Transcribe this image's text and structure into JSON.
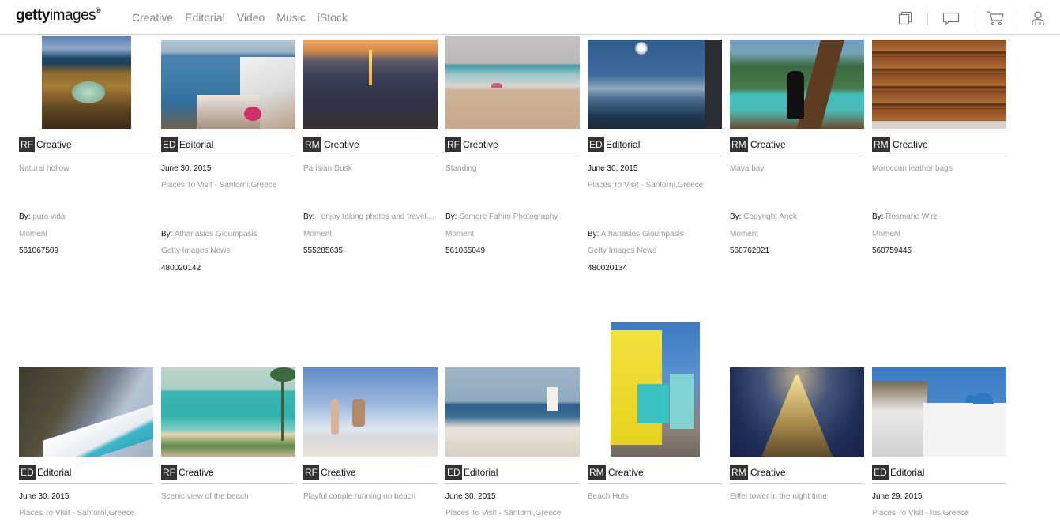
{
  "header": {
    "logo_bold": "getty",
    "logo_light": "images",
    "logo_reg": "®",
    "nav": [
      "Creative",
      "Editorial",
      "Video",
      "Music",
      "iStock"
    ],
    "icons": [
      "boards-icon",
      "chat-icon",
      "cart-icon",
      "user-icon"
    ]
  },
  "by_label": "By:",
  "results": [
    {
      "badge": "RF",
      "type": "Creative",
      "title": "Natural hollow",
      "by": "pura vida",
      "collection": "Moment",
      "id": "561067509",
      "image": "rocky coastline with green pool"
    },
    {
      "badge": "ED",
      "type": "Editorial",
      "date": "June 30, 2015",
      "caption": "Places To Visit - Santorni,Greece",
      "by": "Athanasios Gioumpasis",
      "collection": "Getty Images News",
      "id": "480020142",
      "image": "Santorini white houses over sea"
    },
    {
      "badge": "RM",
      "type": "Creative",
      "title": "Parisian Dusk",
      "by": "I enjoy taking photos and traveli...",
      "collection": "Moment",
      "id": "555285635",
      "image": "Paris at dusk with Eiffel tower"
    },
    {
      "badge": "RF",
      "type": "Creative",
      "title": "Standing",
      "by": "Samere Fahim Photography",
      "collection": "Moment",
      "id": "561065049",
      "image": "beach with umbrella"
    },
    {
      "badge": "ED",
      "type": "Editorial",
      "date": "June 30, 2015",
      "caption": "Places To Visit - Santorni,Greece",
      "by": "Athanasios Gioumpasis",
      "collection": "Getty Images News",
      "id": "480020134",
      "image": "sun over sea from balcony"
    },
    {
      "badge": "RM",
      "type": "Creative",
      "title": "Maya bay",
      "by": "Copyright Anek",
      "collection": "Moment",
      "id": "560762021",
      "image": "woman on longtail boat"
    },
    {
      "badge": "RM",
      "type": "Creative",
      "title": "Moroccan leather bags",
      "by": "Rosmarie Wirz",
      "collection": "Moment",
      "id": "560759445",
      "image": "wall of leather bags"
    },
    {
      "badge": "ED",
      "type": "Editorial",
      "date": "June 30, 2015",
      "caption": "Places To Visit - Santorni,Greece",
      "image": "cliffside pool over sea"
    },
    {
      "badge": "RF",
      "type": "Creative",
      "title": "Scenic view of the beach",
      "image": "turquoise beach with palm"
    },
    {
      "badge": "RF",
      "type": "Creative",
      "title": "Playful couple running on beach",
      "image": "couple jumping on beach"
    },
    {
      "badge": "ED",
      "type": "Editorial",
      "date": "June 30, 2015",
      "caption": "Places To Visit - Santorni,Greece",
      "image": "Oia windmills"
    },
    {
      "badge": "RM",
      "type": "Creative",
      "title": "Beach Huts",
      "image": "colorful beach huts"
    },
    {
      "badge": "RM",
      "type": "Creative",
      "title": "Eiffel tower in the night time",
      "image": "Eiffel tower at night from below"
    },
    {
      "badge": "ED",
      "type": "Editorial",
      "date": "June 29, 2015",
      "caption": "Places To Visit - Ios,Greece",
      "image": "white church with blue domes"
    }
  ]
}
